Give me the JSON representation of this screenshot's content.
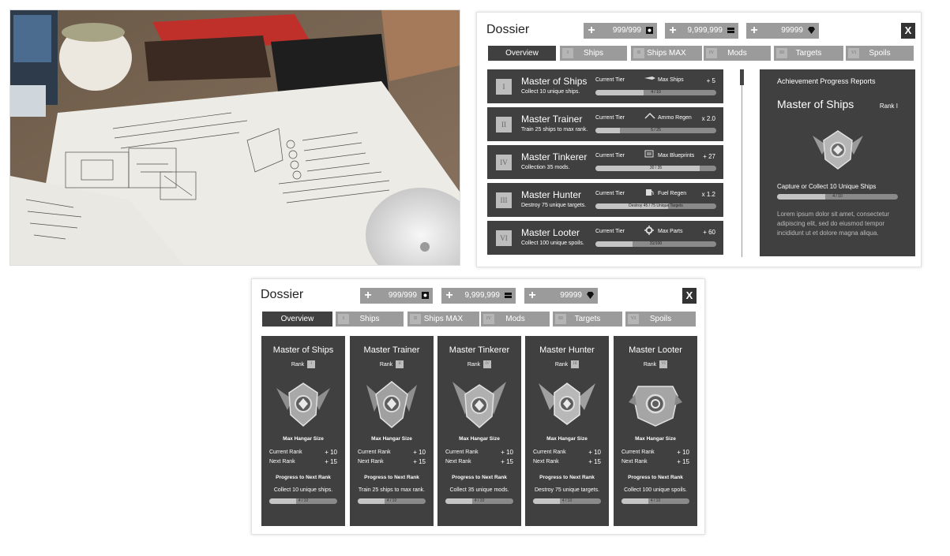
{
  "photo": {
    "description_label": "Desk sketch photo"
  },
  "dossier_a": {
    "title": "Dossier",
    "currencies": [
      {
        "value": "999/999",
        "icon": "ticket-icon"
      },
      {
        "value": "9,999,999",
        "icon": "coins-icon"
      },
      {
        "value": "99999",
        "icon": "gem-icon"
      }
    ],
    "close_label": "X",
    "tabs": [
      {
        "numeral": "",
        "label": "Overview",
        "active": true
      },
      {
        "numeral": "I",
        "label": "Ships"
      },
      {
        "numeral": "II",
        "label": "Ships MAX"
      },
      {
        "numeral": "IV",
        "label": "Mods"
      },
      {
        "numeral": "III",
        "label": "Targets"
      },
      {
        "numeral": "VI",
        "label": "Spoils"
      }
    ],
    "achievements": [
      {
        "numeral": "I",
        "title": "Master of Ships",
        "subtitle": "Collect 10 unique ships.",
        "tier_label": "Current Tier",
        "stat": "Max Ships",
        "bonus": "+ 5",
        "progress_text": "4 / 10",
        "progress": 0.4
      },
      {
        "numeral": "II",
        "title": "Master Trainer",
        "subtitle": "Train 25 ships to max rank.",
        "tier_label": "Current Tier",
        "stat": "Ammo Regen",
        "bonus": "x 2.0",
        "progress_text": "5 / 25",
        "progress": 0.2
      },
      {
        "numeral": "IV",
        "title": "Master Tinkerer",
        "subtitle": "Collection 35 mods.",
        "tier_label": "Current Tier",
        "stat": "Max Blueprints",
        "bonus": "+ 27",
        "progress_text": "30 / 35",
        "progress": 0.86
      },
      {
        "numeral": "III",
        "title": "Master Hunter",
        "subtitle": "Destroy 75 unique targets.",
        "tier_label": "Current Tier",
        "stat": "Fuel Regen",
        "bonus": "x 1.2",
        "progress_text": "Destroy 45 / 75 Unique Targets",
        "progress": 0.6
      },
      {
        "numeral": "VI",
        "title": "Master Looter",
        "subtitle": "Collect 100 unique spoils.",
        "tier_label": "Current Tier",
        "stat": "Max Parts",
        "bonus": "+ 60",
        "progress_text": "31/100",
        "progress": 0.31
      }
    ],
    "detail": {
      "heading": "Achievement Progress Reports",
      "title": "Master of Ships",
      "rank": "Rank I",
      "goal": "Capture or Collect 10 Unique Ships",
      "progress_text": "4 / 10",
      "progress": 0.4,
      "body_lines": [
        "Lorem ipsum dolor sit amet, consectetur",
        "adipiscing elit, sed do eiusmod tempor",
        "incididunt ut et dolore magna aliqua."
      ]
    }
  },
  "dossier_b": {
    "title": "Dossier",
    "currencies": [
      {
        "value": "999/999",
        "icon": "ticket-icon"
      },
      {
        "value": "9,999,999",
        "icon": "coins-icon"
      },
      {
        "value": "99999",
        "icon": "gem-icon"
      }
    ],
    "close_label": "X",
    "tabs": [
      {
        "numeral": "",
        "label": "Overview",
        "active": true
      },
      {
        "numeral": "I",
        "label": "Ships"
      },
      {
        "numeral": "II",
        "label": "Ships MAX"
      },
      {
        "numeral": "IV",
        "label": "Mods"
      },
      {
        "numeral": "III",
        "label": "Targets"
      },
      {
        "numeral": "VI",
        "label": "Spoils"
      }
    ],
    "cards": [
      {
        "title": "Master of Ships",
        "rank_label": "Rank",
        "rank": "I",
        "max_label": "Max Hangar Size",
        "current_label": "Current Rank",
        "current_value": "+ 10",
        "next_label": "Next Rank",
        "next_value": "+ 15",
        "progress_label": "Progress to Next Rank",
        "desc": "Collect 10 unique ships.",
        "progress_text": "4 / 10",
        "progress": 0.4
      },
      {
        "title": "Master Trainer",
        "rank_label": "Rank",
        "rank": "II",
        "max_label": "Max Hangar Size",
        "current_label": "Current Rank",
        "current_value": "+ 10",
        "next_label": "Next Rank",
        "next_value": "+ 15",
        "progress_label": "Progress to Next Rank",
        "desc": "Train 25 ships to max rank.",
        "progress_text": "4 / 10",
        "progress": 0.4
      },
      {
        "title": "Master Tinkerer",
        "rank_label": "Rank",
        "rank": "IV",
        "max_label": "Max Hangar Size",
        "current_label": "Current Rank",
        "current_value": "+ 10",
        "next_label": "Next Rank",
        "next_value": "+ 15",
        "progress_label": "Progress to Next Rank",
        "desc": "Collect 35 unique mods.",
        "progress_text": "4 / 10",
        "progress": 0.4
      },
      {
        "title": "Master Hunter",
        "rank_label": "Rank",
        "rank": "III",
        "max_label": "Max Hangar Size",
        "current_label": "Current Rank",
        "current_value": "+ 10",
        "next_label": "Next Rank",
        "next_value": "+ 15",
        "progress_label": "Progress to Next Rank",
        "desc": "Destroy 75 unique targets.",
        "progress_text": "4 / 10",
        "progress": 0.4
      },
      {
        "title": "Master Looter",
        "rank_label": "Rank",
        "rank": "VI",
        "max_label": "Max Hangar Size",
        "current_label": "Current Rank",
        "current_value": "+ 10",
        "next_label": "Next Rank",
        "next_value": "+ 15",
        "progress_label": "Progress to Next Rank",
        "desc": "Collect 100 unique spoils.",
        "progress_text": "4 / 10",
        "progress": 0.4
      }
    ]
  },
  "colors": {
    "panel_dark": "#404040",
    "tab_gray": "#9b9b9b",
    "bar_track": "#8a8a8a",
    "bar_fill": "#c4c4c4"
  }
}
